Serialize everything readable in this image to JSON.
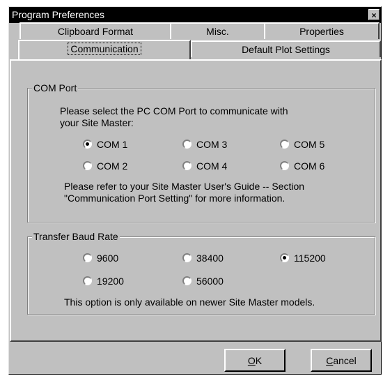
{
  "window": {
    "title": "Program Preferences",
    "close_glyph": "×"
  },
  "tabs": {
    "back_row": [
      {
        "label": "Clipboard Format"
      },
      {
        "label": "Misc."
      },
      {
        "label": "Properties"
      }
    ],
    "front_row": [
      {
        "label": "Communication",
        "active": true
      },
      {
        "label": "Default Plot Settings",
        "active": false
      }
    ]
  },
  "com_port": {
    "group_title": "COM Port",
    "prompt_line1": "Please select the PC COM Port to communicate with",
    "prompt_line2": "your Site Master:",
    "options": [
      {
        "label": "COM 1",
        "selected": true
      },
      {
        "label": "COM 3",
        "selected": false
      },
      {
        "label": "COM 5",
        "selected": false
      },
      {
        "label": "COM 2",
        "selected": false
      },
      {
        "label": "COM 4",
        "selected": false
      },
      {
        "label": "COM 6",
        "selected": false
      }
    ],
    "note_line1": "Please refer to your Site Master User's Guide  -- Section",
    "note_line2": "\"Communication Port Setting\" for more information."
  },
  "baud_rate": {
    "group_title": "Transfer Baud Rate",
    "options": [
      {
        "label": "9600",
        "selected": false
      },
      {
        "label": "38400",
        "selected": false
      },
      {
        "label": "115200",
        "selected": true
      },
      {
        "label": "19200",
        "selected": false
      },
      {
        "label": "56000",
        "selected": false
      }
    ],
    "note": "This option is only available on newer Site Master models."
  },
  "buttons": {
    "ok": {
      "label_rest": "K",
      "mnemonic": "O"
    },
    "cancel": {
      "label_rest": "ancel",
      "mnemonic": "C"
    }
  }
}
